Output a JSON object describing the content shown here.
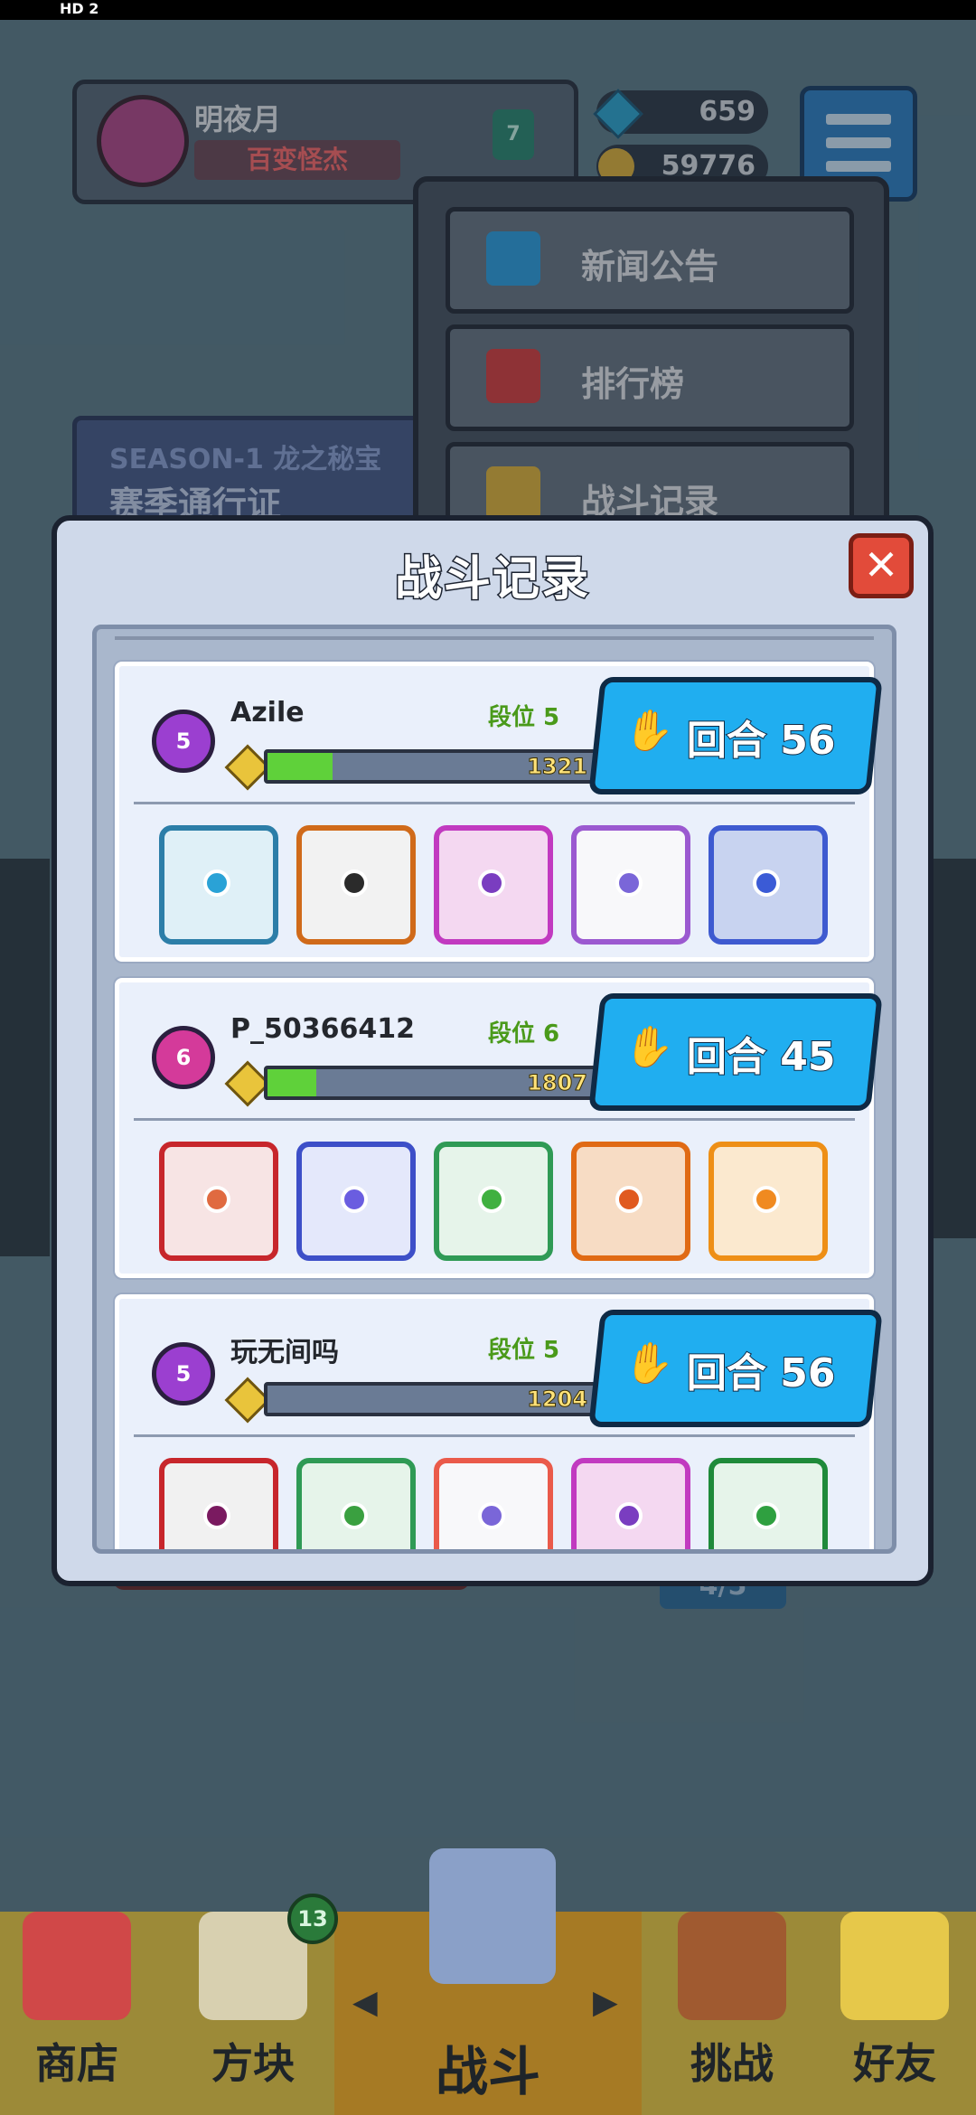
{
  "status": {
    "hd": "HD 2"
  },
  "profile": {
    "name": "明夜月",
    "title": "百变怪杰",
    "level": "7"
  },
  "resources": {
    "gems": "659",
    "coins": "59776"
  },
  "menu": {
    "items": [
      {
        "label": "新闻公告",
        "icon": "news-icon",
        "color": "#2ea0e0"
      },
      {
        "label": "排行榜",
        "icon": "leaderboard-icon",
        "color": "#d84040"
      },
      {
        "label": "战斗记录",
        "icon": "battle-record-icon",
        "color": "#e2b53a"
      }
    ]
  },
  "season": {
    "line1": "SEASON-1 龙之秘宝",
    "line2": "赛季通行证"
  },
  "background": {
    "counter": "4/5"
  },
  "modal": {
    "title": "战斗记录",
    "close": "✕"
  },
  "records": [
    {
      "player": "Azile",
      "tier_label": "段位 5",
      "rank": "5",
      "rank_color": "#9b3fd0",
      "xp": "1321",
      "xp_fill": 0.2,
      "round_label": "回合 56",
      "dice": [
        {
          "name": "vortex-dice",
          "border": "#2c7ea8",
          "fill": "#dff0f7",
          "pip": "#2aa2d6"
        },
        {
          "name": "gun-dice",
          "border": "#d06a1a",
          "fill": "#f2f2f2",
          "pip": "#2b2b2b"
        },
        {
          "name": "arrow-dice",
          "border": "#c13ac0",
          "fill": "#f4d8f1",
          "pip": "#7a3dc0"
        },
        {
          "name": "rainbow-dice",
          "border": "#9b59d0",
          "fill": "#f8f8fa",
          "pip": "#7a66d8"
        },
        {
          "name": "gear-dice",
          "border": "#3e5ad0",
          "fill": "#c8d3f0",
          "pip": "#3b5bd6"
        }
      ]
    },
    {
      "player": "P_50366412",
      "tier_label": "段位 6",
      "rank": "6",
      "rank_color": "#d43a9a",
      "xp": "1807",
      "xp_fill": 0.15,
      "round_label": "回合 45",
      "dice": [
        {
          "name": "star-dice",
          "border": "#c7262b",
          "fill": "#f7e4e4",
          "pip": "#e06a40"
        },
        {
          "name": "moon-dice",
          "border": "#3d4fc8",
          "fill": "#e4e8fb",
          "pip": "#6a5de0"
        },
        {
          "name": "seal-dice",
          "border": "#2f9a55",
          "fill": "#e6f4ea",
          "pip": "#40b040"
        },
        {
          "name": "fire-dice",
          "border": "#e06a14",
          "fill": "#f7dcc4",
          "pip": "#e05a20"
        },
        {
          "name": "target-dice",
          "border": "#ee8f16",
          "fill": "#fbe9cf",
          "pip": "#f08a20"
        }
      ]
    },
    {
      "player": "玩无间吗",
      "tier_label": "段位 5",
      "rank": "5",
      "rank_color": "#9b3fd0",
      "xp": "1204",
      "xp_fill": 0.0,
      "round_label": "回合 56",
      "dice": [
        {
          "name": "saw-dice",
          "border": "#c7262b",
          "fill": "#f1f1f1",
          "pip": "#7a1a60"
        },
        {
          "name": "green-seal-dice",
          "border": "#2f9a55",
          "fill": "#e6f4ea",
          "pip": "#3aa040"
        },
        {
          "name": "prism-dice",
          "border": "#ea5a4a",
          "fill": "#f8f8fa",
          "pip": "#7a66d8"
        },
        {
          "name": "arrow-dice",
          "border": "#c13ac0",
          "fill": "#f4d8f1",
          "pip": "#7a3dc0"
        },
        {
          "name": "grass-dice",
          "border": "#1f8a3a",
          "fill": "#e6f4ea",
          "pip": "#2fa040"
        }
      ]
    }
  ],
  "nav": {
    "tabs": [
      {
        "label": "商店",
        "icon": "shop-icon",
        "color": "#d04848"
      },
      {
        "label": "方块",
        "icon": "dice-collection-icon",
        "color": "#d8d0b0",
        "badge": "13"
      },
      {
        "label": "战斗",
        "icon": "battle-icon",
        "color": "#8aa0c8"
      },
      {
        "label": "挑战",
        "icon": "challenge-icon",
        "color": "#a05a30"
      },
      {
        "label": "好友",
        "icon": "friends-icon",
        "color": "#e6c84a"
      }
    ]
  }
}
